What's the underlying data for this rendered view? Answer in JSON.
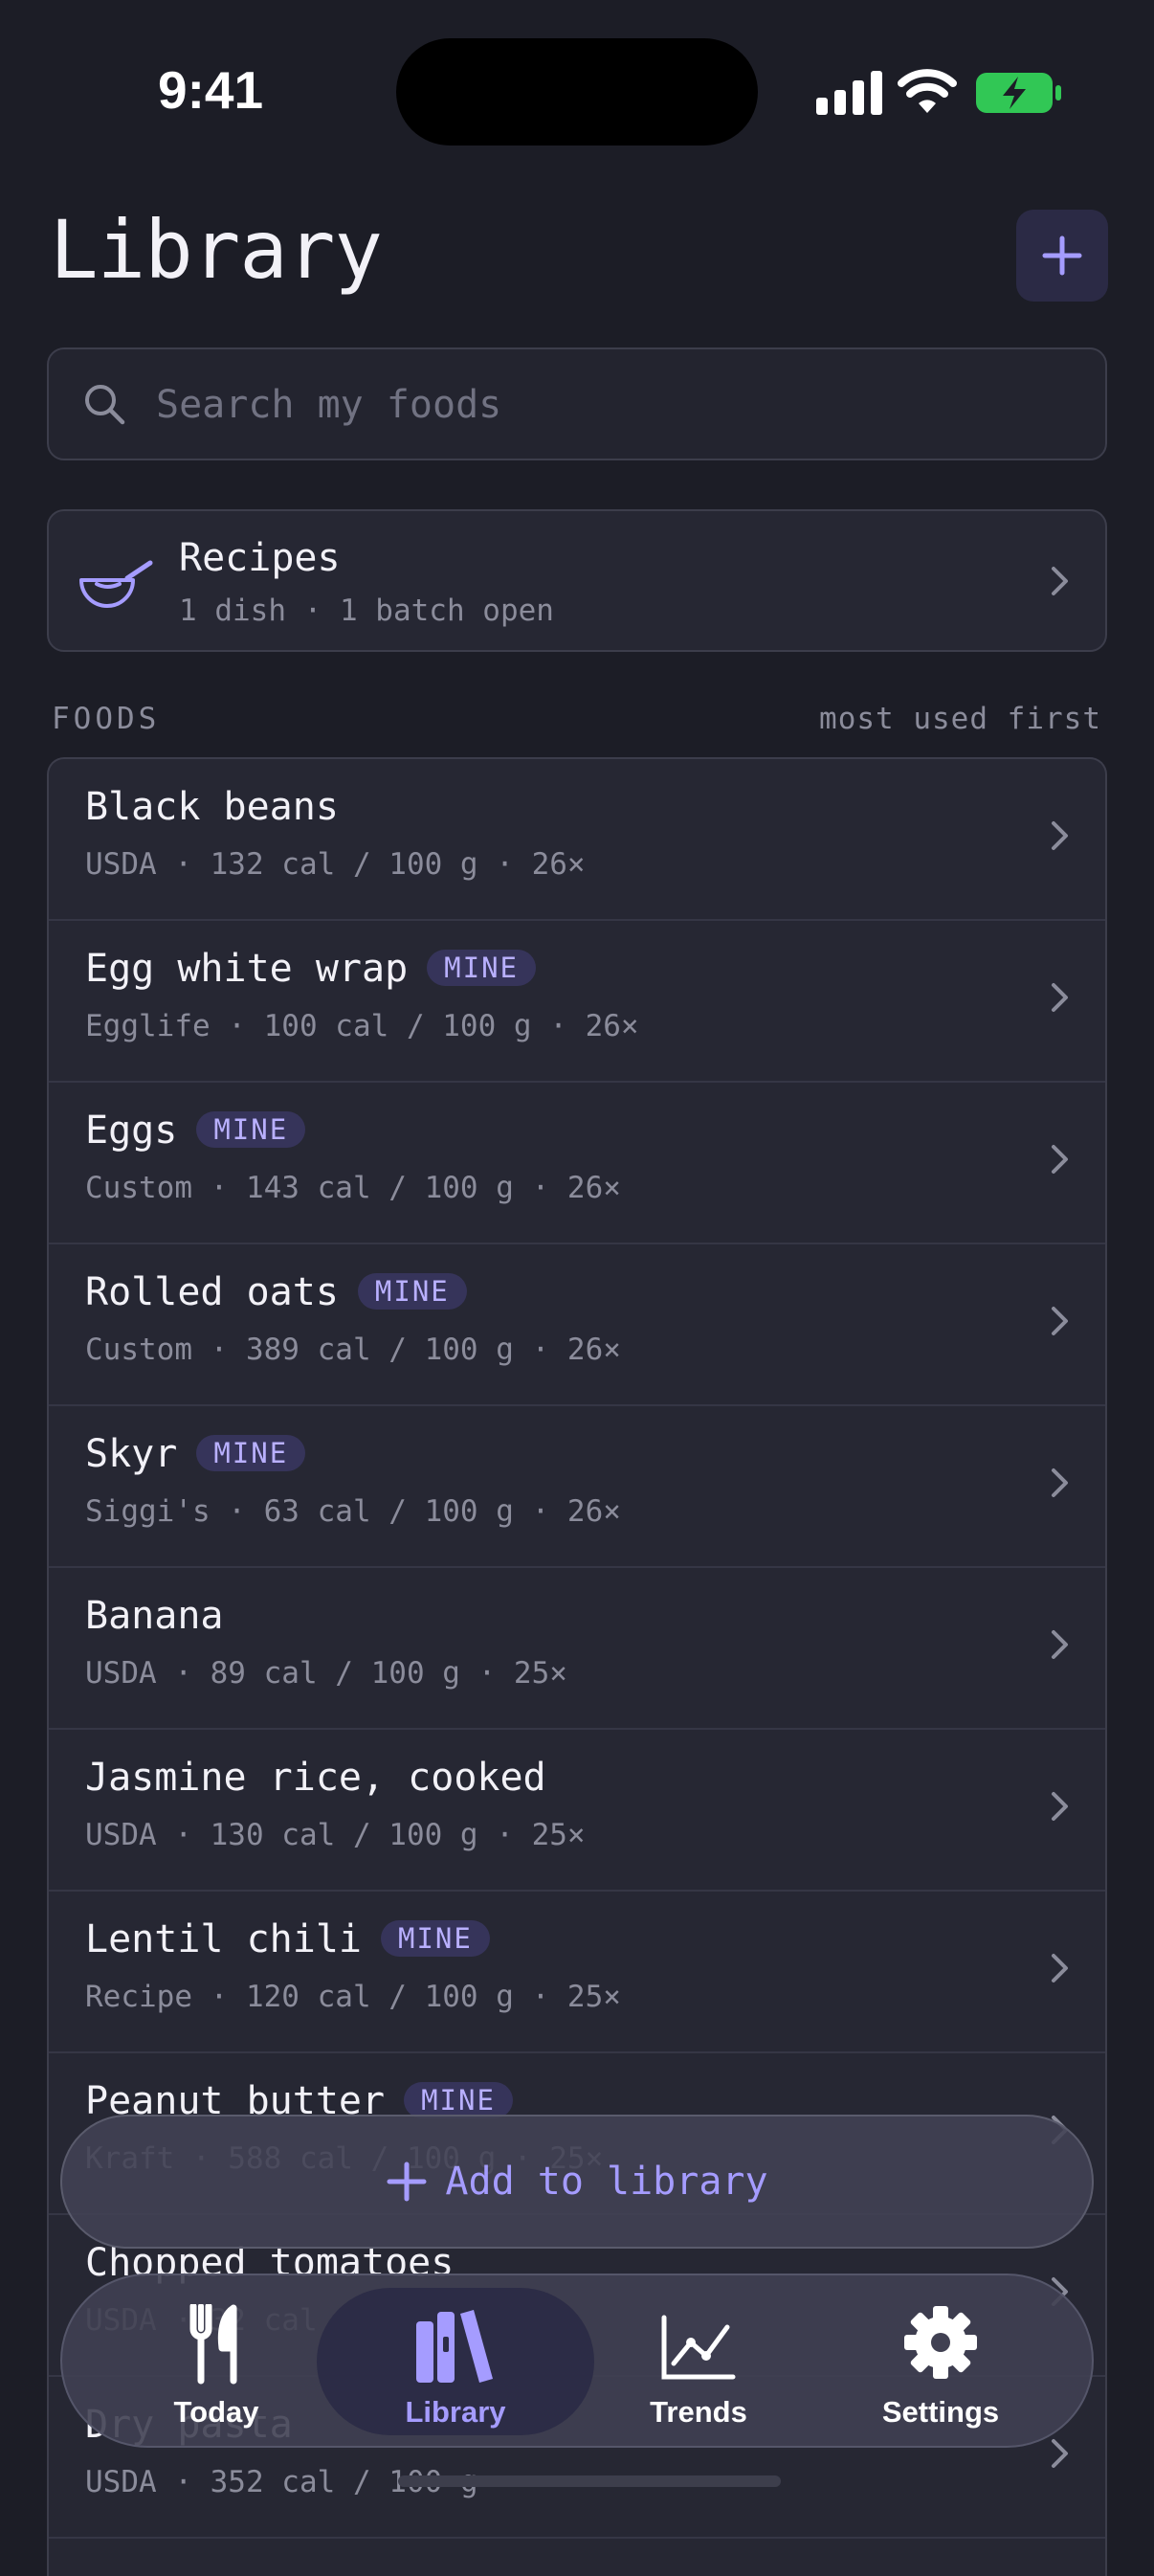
{
  "status": {
    "time": "9:41"
  },
  "header": {
    "title": "Library",
    "add_icon": "plus-icon"
  },
  "search": {
    "placeholder": "Search my foods"
  },
  "recipes": {
    "title": "Recipes",
    "subtitle": "1 dish · 1 batch open"
  },
  "foods_section": {
    "label": "FOODS",
    "sort": "most used first"
  },
  "foods": [
    {
      "name": "Black beans",
      "mine": false,
      "meta": "USDA · 132 cal / 100 g · 26×"
    },
    {
      "name": "Egg white wrap",
      "mine": true,
      "meta": "Egglife · 100 cal / 100 g · 26×"
    },
    {
      "name": "Eggs",
      "mine": true,
      "meta": "Custom · 143 cal / 100 g · 26×"
    },
    {
      "name": "Rolled oats",
      "mine": true,
      "meta": "Custom · 389 cal / 100 g · 26×"
    },
    {
      "name": "Skyr",
      "mine": true,
      "meta": "Siggi's · 63 cal / 100 g · 26×"
    },
    {
      "name": "Banana",
      "mine": false,
      "meta": "USDA · 89 cal / 100 g · 25×"
    },
    {
      "name": "Jasmine rice, cooked",
      "mine": false,
      "meta": "USDA · 130 cal / 100 g · 25×"
    },
    {
      "name": "Lentil chili",
      "mine": true,
      "meta": "Recipe · 120 cal / 100 g · 25×"
    },
    {
      "name": "Peanut butter",
      "mine": true,
      "meta": "Kraft · 588 cal / 100 g · 25×"
    },
    {
      "name": "Chopped tomatoes",
      "mine": false,
      "meta": "USDA · 32 cal / 100 g · 25×"
    },
    {
      "name": "Dry pasta",
      "mine": false,
      "meta": "USDA · 352 cal / 100 g"
    }
  ],
  "badge_label": "MINE",
  "add_to_library": {
    "label": "Add to library"
  },
  "tabs": [
    {
      "label": "Today",
      "icon": "fork-knife-icon",
      "active": false
    },
    {
      "label": "Library",
      "icon": "books-icon",
      "active": true
    },
    {
      "label": "Trends",
      "icon": "chart-line-icon",
      "active": false
    },
    {
      "label": "Settings",
      "icon": "gear-icon",
      "active": false
    }
  ],
  "colors": {
    "background": "#1c1d26",
    "accent": "#a59cff",
    "badge_bg": "#36345a"
  }
}
